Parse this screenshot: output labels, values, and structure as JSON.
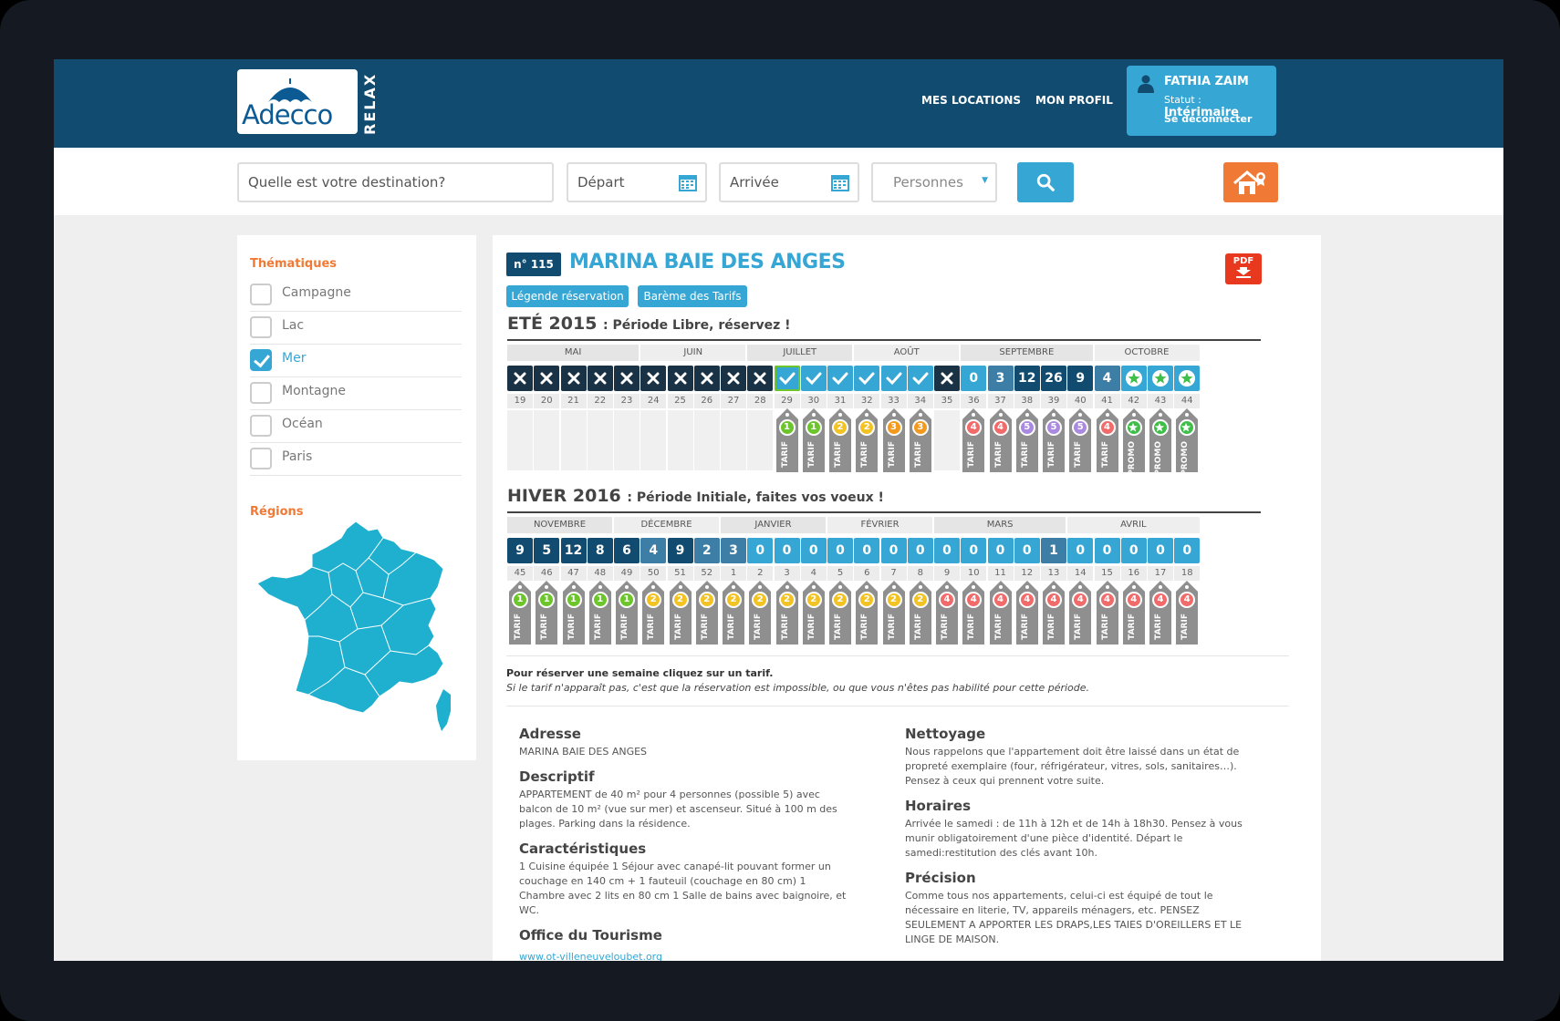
{
  "brand": {
    "word": "Adecco",
    "sub": "RELAX"
  },
  "nav": {
    "locations": "MES LOCATIONS",
    "profile": "MON PROFIL"
  },
  "user": {
    "name": "FATHIA ZAIM",
    "status_label": "Statut :",
    "status_value": "Intérimaire",
    "logout": "Se déconnecter"
  },
  "search": {
    "destination": "Quelle est votre destination?",
    "departure": "Départ",
    "arrival": "Arrivée",
    "persons": "Personnes"
  },
  "sidebar": {
    "themes_title": "Thématiques",
    "themes": [
      {
        "label": "Campagne",
        "checked": false
      },
      {
        "label": "Lac",
        "checked": false
      },
      {
        "label": "Mer",
        "checked": true
      },
      {
        "label": "Montagne",
        "checked": false
      },
      {
        "label": "Océan",
        "checked": false
      },
      {
        "label": "Paris",
        "checked": false
      }
    ],
    "regions_title": "Régions"
  },
  "property": {
    "number": "n° 115",
    "title": "MARINA BAIE DES ANGES",
    "pdf": "PDF",
    "btn_legend": "Légende réservation",
    "btn_tariffs": "Barème des Tarifs"
  },
  "seasons": {
    "summer": {
      "title": "ETÉ 2015",
      "subtitle": ": Période Libre, réservez !",
      "months": [
        [
          "MAI",
          5
        ],
        [
          "JUIN",
          4
        ],
        [
          "JUILLET",
          4
        ],
        [
          "AOÛT",
          4
        ],
        [
          "SEPTEMBRE",
          5
        ],
        [
          "OCTOBRE",
          4
        ]
      ],
      "days": [
        "x",
        "x",
        "x",
        "x",
        "x",
        "x",
        "x",
        "x",
        "x",
        "x",
        "v",
        "v",
        "v",
        "v",
        "v",
        "v",
        "x",
        "0",
        "3",
        "12",
        "26",
        "9",
        "4",
        "s",
        "s",
        "s"
      ],
      "weeks": [
        "19",
        "20",
        "21",
        "22",
        "23",
        "24",
        "25",
        "26",
        "27",
        "28",
        "29",
        "30",
        "31",
        "32",
        "33",
        "34",
        "35",
        "36",
        "37",
        "38",
        "39",
        "40",
        "41",
        "42",
        "43",
        "44"
      ],
      "tags": [
        null,
        null,
        null,
        null,
        null,
        null,
        null,
        null,
        null,
        null,
        "1",
        "1",
        "2",
        "2",
        "3",
        "3",
        null,
        "4",
        "4",
        "5",
        "5",
        "5",
        "4",
        "P",
        "P",
        "P"
      ]
    },
    "winter": {
      "title": "HIVER 2016",
      "subtitle": ": Période Initiale, faites vos voeux !",
      "months": [
        [
          "NOVEMBRE",
          4
        ],
        [
          "DÉCEMBRE",
          4
        ],
        [
          "JANVIER",
          4
        ],
        [
          "FÉVRIER",
          4
        ],
        [
          "MARS",
          5
        ],
        [
          "AVRIL",
          5
        ]
      ],
      "days": [
        "9",
        "5",
        "12",
        "8",
        "6",
        "4",
        "9",
        "2",
        "3",
        "0",
        "0",
        "0",
        "0",
        "0",
        "0",
        "0",
        "0",
        "0",
        "0",
        "0",
        "1",
        "0",
        "0",
        "0",
        "0",
        "0"
      ],
      "weeks": [
        "45",
        "46",
        "47",
        "48",
        "49",
        "50",
        "51",
        "52",
        "1",
        "2",
        "3",
        "4",
        "5",
        "6",
        "7",
        "8",
        "9",
        "10",
        "11",
        "12",
        "13",
        "14",
        "15",
        "16",
        "17",
        "18"
      ],
      "tags": [
        "1",
        "1",
        "1",
        "1",
        "1",
        "2",
        "2",
        "2",
        "2",
        "2",
        "2",
        "2",
        "2",
        "2",
        "2",
        "2",
        "4",
        "4",
        "4",
        "4",
        "4",
        "4",
        "4",
        "4",
        "4",
        "4"
      ]
    }
  },
  "tag_labels": {
    "tarif": "TARIF",
    "promo": "PROMO"
  },
  "colors": {
    "navy": "#114b6f",
    "blue": "#36a6d4",
    "orange": "#f07a35",
    "t1": "#6cc52a",
    "t2": "#f3c223",
    "t3": "#f39a1e",
    "t4": "#f26b6b",
    "t5": "#a98ae0",
    "promo": "#3fbf4a"
  },
  "note": {
    "bold": "Pour réserver une semaine cliquez sur un tarif.",
    "italic": "Si le tarif n'apparaît pas, c'est que la réservation est impossible, ou que vous n'êtes pas habilité pour cette période."
  },
  "details": {
    "left": [
      {
        "title": "Adresse",
        "text": "MARINA BAIE DES ANGES"
      },
      {
        "title": "Descriptif",
        "text": "APPARTEMENT de 40 m² pour 4 personnes (possible 5) avec balcon de 10 m² (vue sur mer) et ascenseur. Situé à 100 m des plages. Parking dans la résidence."
      },
      {
        "title": "Caractéristiques",
        "text": "1 Cuisine équipée 1 Séjour avec canapé-lit pouvant former un couchage en 140 cm + 1 fauteuil (couchage en 80 cm) 1 Chambre avec 2 lits en 80 cm 1 Salle de bains avec baignoire, et WC."
      },
      {
        "title": "Office du Tourisme",
        "link": "www.ot-villeneuveloubet.org"
      }
    ],
    "right": [
      {
        "title": "Nettoyage",
        "text": "Nous rappelons que l'appartement doit être laissé dans un état de propreté exemplaire (four, réfrigérateur, vitres, sols, sanitaires…). Pensez à ceux qui prennent votre suite."
      },
      {
        "title": "Horaires",
        "text": "Arrivée le samedi : de 11h à 12h et de 14h à 18h30. Pensez à vous munir obligatoirement d'une pièce d'identité. Départ le samedi:restitution des clés avant 10h."
      },
      {
        "title": "Précision",
        "text": "Comme tous nos appartements, celui-ci est équipé de tout le nécessaire en literie, TV, appareils ménagers, etc. PENSEZ SEULEMENT A APPORTER LES DRAPS,LES TAIES D'OREILLERS ET LE LINGE DE MAISON."
      }
    ]
  }
}
